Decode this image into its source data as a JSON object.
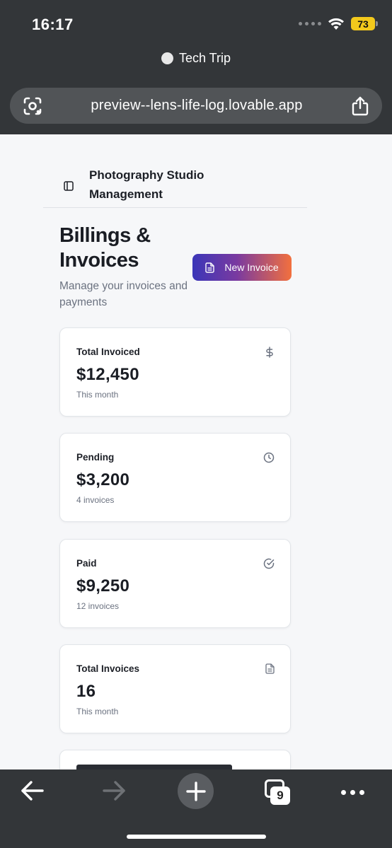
{
  "status_bar": {
    "time": "16:17",
    "battery": "73"
  },
  "browser": {
    "tab_title": "Tech Trip",
    "url": "preview--lens-life-log.lovable.app",
    "tabs_count": "9"
  },
  "app": {
    "title": "Photography Studio Management"
  },
  "page": {
    "title": "Billings & Invoices",
    "subtitle": "Manage your invoices and payments",
    "new_invoice_label": "New Invoice"
  },
  "cards": [
    {
      "label": "Total Invoiced",
      "value": "$12,450",
      "note": "This month",
      "icon": "dollar-icon"
    },
    {
      "label": "Pending",
      "value": "$3,200",
      "note": "4 invoices",
      "icon": "clock-icon"
    },
    {
      "label": "Paid",
      "value": "$9,250",
      "note": "12 invoices",
      "icon": "check-circle-icon"
    },
    {
      "label": "Total Invoices",
      "value": "16",
      "note": "This month",
      "icon": "document-icon"
    }
  ],
  "colors": {
    "chrome": "#333639",
    "gradient_start": "#3b36b8",
    "gradient_end": "#f2703e",
    "battery": "#f3c91c"
  }
}
